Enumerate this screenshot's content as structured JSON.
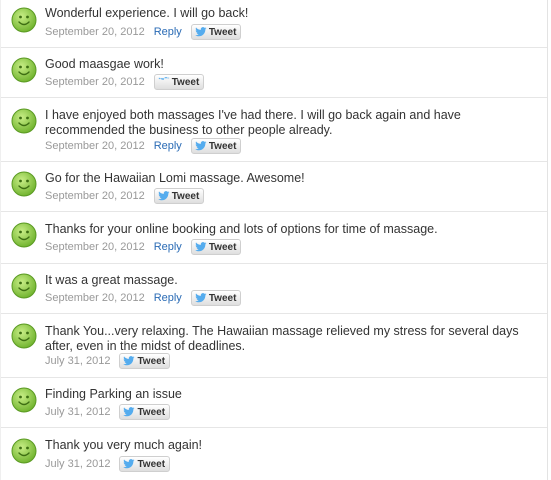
{
  "colors": {
    "text": "#333333",
    "meta": "#999999",
    "reply_link": "#2a6bb5",
    "face_green": "#7ec23a",
    "twitter_bird": "#55acee"
  },
  "icons": {
    "face": "smiley-face-icon",
    "tweet": "twitter-bird-icon"
  },
  "reviews": [
    {
      "text": "Wonderful experience. I will go back!",
      "date": "September 20, 2012",
      "reply": "Reply",
      "tweet": "Tweet"
    },
    {
      "text": "Good maasgae work!",
      "date": "September 20, 2012",
      "reply": "",
      "tweet": "Tweet"
    },
    {
      "text": "I have enjoyed both massages I've had there. I will go back again and have recommended the business to other people already.",
      "date": "September 20, 2012",
      "reply": "Reply",
      "tweet": "Tweet"
    },
    {
      "text": "Go for the Hawaiian Lomi massage. Awesome!",
      "date": "September 20, 2012",
      "reply": "",
      "tweet": "Tweet"
    },
    {
      "text": "Thanks for your online booking and lots of options for time of massage.",
      "date": "September 20, 2012",
      "reply": "Reply",
      "tweet": "Tweet"
    },
    {
      "text": "It was a great massage.",
      "date": "September 20, 2012",
      "reply": "Reply",
      "tweet": "Tweet"
    },
    {
      "text": "Thank You...very relaxing. The Hawaiian massage relieved my stress for several days after, even in the midst of deadlines.",
      "date": "July 31, 2012",
      "reply": "",
      "tweet": "Tweet"
    },
    {
      "text": "Finding Parking an issue",
      "date": "July 31, 2012",
      "reply": "",
      "tweet": "Tweet"
    },
    {
      "text": "Thank you very much again!",
      "date": "July 31, 2012",
      "reply": "",
      "tweet": "Tweet"
    }
  ]
}
